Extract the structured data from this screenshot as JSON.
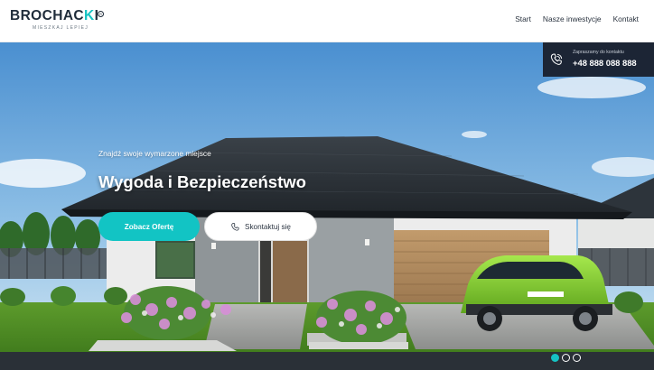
{
  "brand": {
    "name_main": "BROCHAC",
    "name_accent": "K",
    "name_end": "I",
    "trademark": "R",
    "tagline": "MIESZKAJ LEPIEJ"
  },
  "nav": {
    "items": [
      {
        "label": "Start"
      },
      {
        "label": "Nasze inwestycje"
      },
      {
        "label": "Kontakt"
      }
    ]
  },
  "contact": {
    "label": "Zapraszamy do kontaktu",
    "phone": "+48 888 088 888"
  },
  "hero": {
    "subtitle": "Znajdź swoje wymarzone miejsce",
    "title": "Wygoda i Bezpieczeństwo",
    "primary_button": "Zobacz Ofertę",
    "secondary_button": "Skontaktuj się"
  },
  "slider": {
    "slide_count": 3,
    "active_index": 0
  },
  "colors": {
    "accent": "#16c3c3",
    "dark": "#1c2535",
    "text": "#2b3440"
  }
}
